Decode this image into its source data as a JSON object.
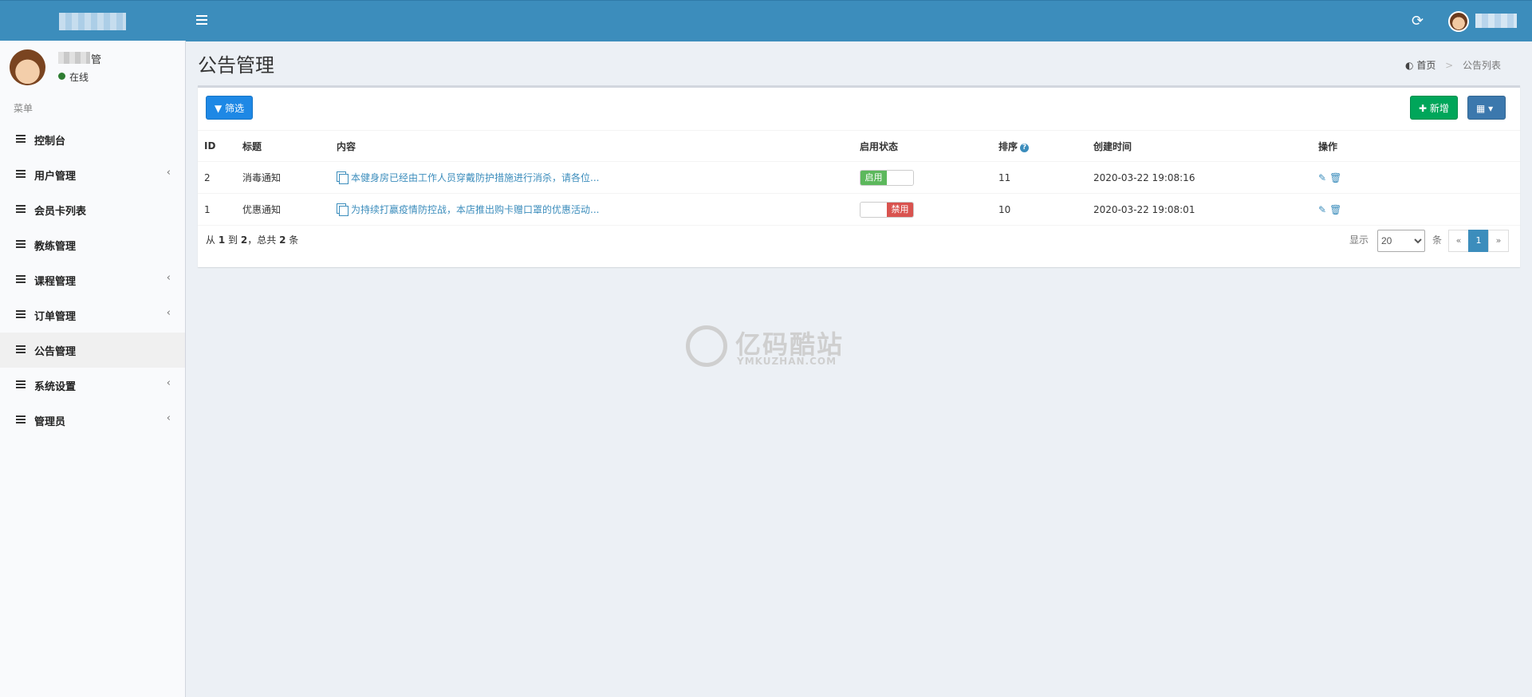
{
  "header": {
    "refresh_icon": "refresh-icon"
  },
  "sidebar": {
    "user_suffix": "管",
    "status": "在线",
    "menu_header": "菜单",
    "items": [
      {
        "label": "控制台",
        "icon": "bar-chart-icon",
        "has_children": false
      },
      {
        "label": "用户管理",
        "icon": "list-icon",
        "has_children": true
      },
      {
        "label": "会员卡列表",
        "icon": "list-icon",
        "has_children": false
      },
      {
        "label": "教练管理",
        "icon": "list-icon",
        "has_children": false
      },
      {
        "label": "课程管理",
        "icon": "list-icon",
        "has_children": true
      },
      {
        "label": "订单管理",
        "icon": "list-icon",
        "has_children": true
      },
      {
        "label": "公告管理",
        "icon": "list-icon",
        "has_children": false,
        "active": true
      },
      {
        "label": "系统设置",
        "icon": "list-icon",
        "has_children": true
      },
      {
        "label": "管理员",
        "icon": "table-icon",
        "has_children": true
      }
    ]
  },
  "page": {
    "title": "公告管理",
    "breadcrumb": [
      "首页",
      "公告列表"
    ]
  },
  "toolbar": {
    "filter_label": "筛选",
    "add_label": "新增",
    "columns_icon": "columns-icon"
  },
  "table": {
    "headers": [
      "ID",
      "标题",
      "内容",
      "启用状态",
      "排序",
      "创建时间",
      "操作"
    ],
    "rows": [
      {
        "id": "2",
        "title": "消毒通知",
        "content": "本健身房已经由工作人员穿戴防护措施进行消杀，请各位...",
        "enabled": true,
        "status_on": "启用",
        "sort": "11",
        "created": "2020-03-22 19:08:16"
      },
      {
        "id": "1",
        "title": "优惠通知",
        "content": "为持续打赢疫情防控战，本店推出购卡赠口罩的优惠活动...",
        "enabled": false,
        "status_off": "禁用",
        "sort": "10",
        "created": "2020-03-22 19:08:01"
      }
    ],
    "summary": {
      "prefix": "从",
      "from": "1",
      "to_word": "到",
      "to": "2",
      "total_word": "，总共",
      "total": "2",
      "unit": "条"
    },
    "pager": {
      "show_label": "显示",
      "page_size": "20",
      "unit_label": "条",
      "prev": "«",
      "current": "1",
      "next": "»"
    }
  },
  "watermark": {
    "title": "亿码酷站",
    "subtitle": "YMKUZHAN.COM"
  }
}
